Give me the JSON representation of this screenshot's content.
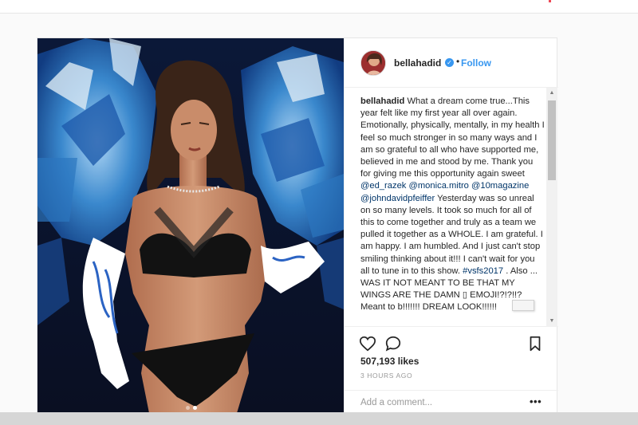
{
  "post": {
    "username": "bellahadid",
    "separator": "•",
    "follow_label": "Follow",
    "verified_glyph": "✓",
    "caption": {
      "part1": "What a dream come true...This year felt like my first year all over again. Emotionally, physically, mentally, in my health I feel so much stronger in so many ways and I am so grateful to all who have supported me, believed in me and stood by me. Thank you for giving me this opportunity again sweet",
      "mention1": "@ed_razek",
      "mention2": "@monica.mitro",
      "mention3": "@10magazine",
      "mention4": "@johndavidpfeiffer",
      "part2": "Yesterday was so unreal on so many levels. It took so much for all of this to come together and truly as a team we pulled it together as a WHOLE. I am grateful. I am happy. I am humbled. And I just can't stop smiling thinking about it!!! I can't wait for you all to tune in to this show.",
      "hashtag": "#vsfs2017",
      "part3": ". Also ... WAS IT NOT MEANT TO BE THAT MY WINGS ARE THE DAMN ▯ EMOJI!?!?!!? Meant to b!!!!!!! DREAM LOOK!!!!!!"
    },
    "likes": "507,193 likes",
    "timestamp": "3 HOURS AGO",
    "comment_placeholder": "Add a comment...",
    "more_label": "•••"
  },
  "icons": {
    "like": "heart-outline-icon",
    "comment": "speech-bubble-icon",
    "save": "bookmark-outline-icon",
    "verified": "verified-badge-icon"
  },
  "carousel": {
    "count": 2,
    "active_index": 1
  },
  "colors": {
    "link": "#003569",
    "follow": "#3897f0",
    "verified": "#3897f0",
    "muted": "#999999",
    "border": "#efefef"
  }
}
